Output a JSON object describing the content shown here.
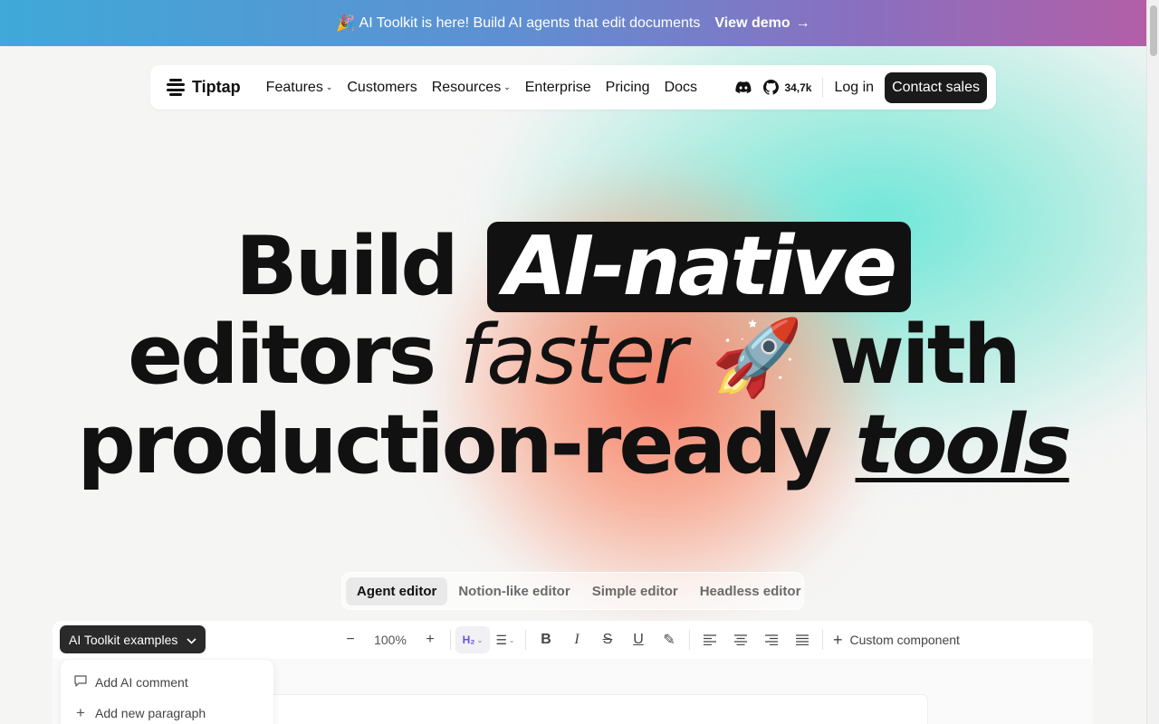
{
  "announcement": {
    "emoji": "🎉",
    "text": "AI Toolkit is here! Build AI agents that edit documents",
    "cta": "View demo",
    "cta_arrow": "→"
  },
  "nav": {
    "brand": "Tiptap",
    "links": [
      {
        "label": "Features",
        "dropdown": true
      },
      {
        "label": "Customers",
        "dropdown": false
      },
      {
        "label": "Resources",
        "dropdown": true
      },
      {
        "label": "Enterprise",
        "dropdown": false
      },
      {
        "label": "Pricing",
        "dropdown": false
      },
      {
        "label": "Docs",
        "dropdown": false
      }
    ],
    "github_stars": "34,7k",
    "login": "Log in",
    "contact": "Contact sales",
    "icons": {
      "discord": "discord-icon",
      "github": "github-icon"
    }
  },
  "hero": {
    "line1_a": "Build",
    "line1_pill": "AI-native",
    "line2_a": "editors",
    "line2_light": "faster",
    "line2_emoji": "🚀",
    "line2_b": "with",
    "line3_a": "production-ready",
    "line3_under": "tools"
  },
  "tabs": [
    {
      "label": "Agent editor",
      "active": true
    },
    {
      "label": "Notion-like editor",
      "active": false
    },
    {
      "label": "Simple editor",
      "active": false
    },
    {
      "label": "Headless editor",
      "active": false
    }
  ],
  "editor": {
    "examples_select": "AI Toolkit examples",
    "zoom": "100%",
    "heading_button": "H₂",
    "custom_component": "Custom component",
    "menu": [
      {
        "label": "Add AI comment",
        "icon": "comment-icon"
      },
      {
        "label": "Add new paragraph",
        "icon": "plus-icon"
      }
    ]
  },
  "colors": {
    "announcement_start": "#3fa9d8",
    "announcement_end": "#b25fa6",
    "glow_teal": "#54e4d4",
    "glow_salmon": "#f67860",
    "dark": "#111111",
    "heading_accent": "#6b4fe0"
  }
}
